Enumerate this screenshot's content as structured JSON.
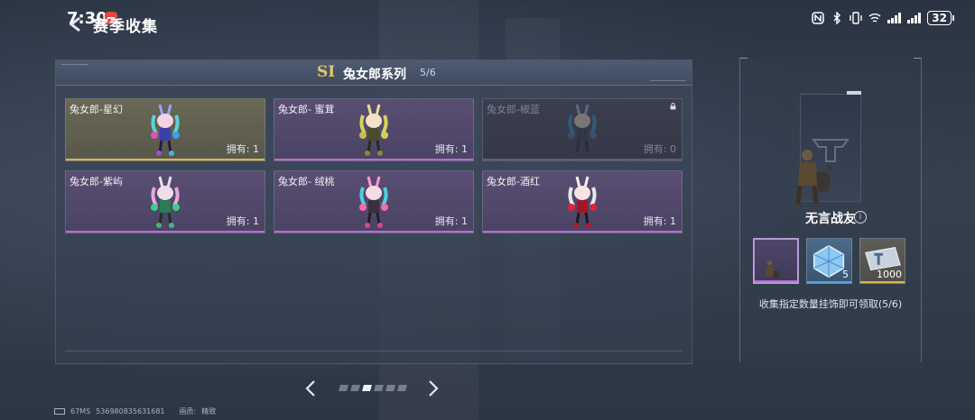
{
  "status_bar": {
    "time": "7:30",
    "battery": "32"
  },
  "header": {
    "title": "赛季收集"
  },
  "series": {
    "badge": "SI",
    "title": "兔女郎系列",
    "count": "5/6"
  },
  "cards": [
    {
      "name": "兔女郎-星幻",
      "owned": "拥有: 1",
      "rarity": "gold",
      "locked": false
    },
    {
      "name": "兔女郎- 蜜茸",
      "owned": "拥有: 1",
      "rarity": "purple",
      "locked": false
    },
    {
      "name": "兔女郎-椒蓝",
      "owned": "拥有: 0",
      "rarity": "purple",
      "locked": true
    },
    {
      "name": "兔女郎-紫屿",
      "owned": "拥有: 1",
      "rarity": "purple",
      "locked": false
    },
    {
      "name": "兔女郎- 绒桃",
      "owned": "拥有: 1",
      "rarity": "purple",
      "locked": false
    },
    {
      "name": "兔女郎-酒红",
      "owned": "拥有: 1",
      "rarity": "purple",
      "locked": false
    }
  ],
  "pager": {
    "total_pages": 6,
    "active_index": 2
  },
  "reward": {
    "name": "无言战友",
    "description": "收集指定数量挂饰即可领取(5/6)",
    "items": [
      {
        "count": "",
        "icon": "soldier-with-dog-icon"
      },
      {
        "count": "5",
        "icon": "blue-crystal-box-icon"
      },
      {
        "count": "1000",
        "icon": "ticket-card-icon"
      }
    ]
  },
  "footer": {
    "ping": "67MS",
    "id": "536980835631681",
    "quality_label": "画质:",
    "quality_value": "精致"
  },
  "colors": {
    "gold": "#d8b64f",
    "purple": "#b86ad6",
    "blue": "#5a9ee0",
    "accent_text": "#e6c36a"
  }
}
